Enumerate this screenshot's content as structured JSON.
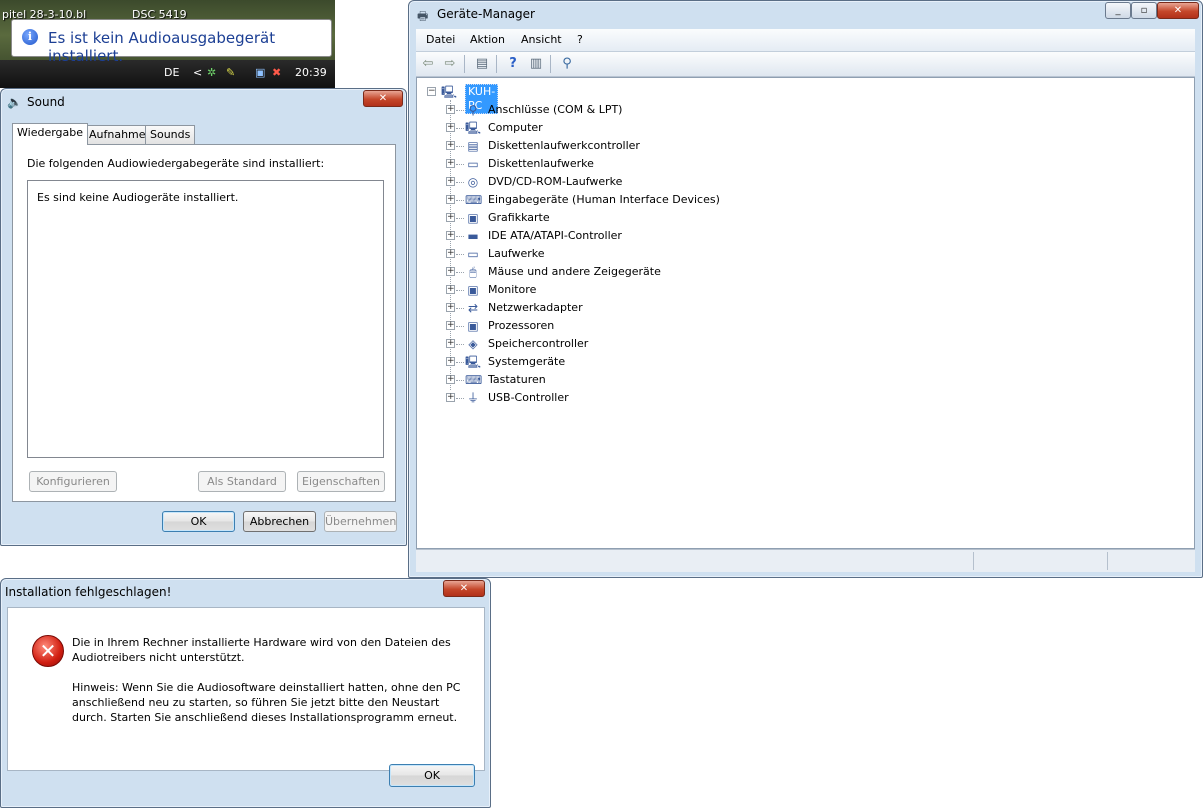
{
  "desktop": {
    "label_left": "pitel 28-3-10.bl",
    "label_right": "DSC 5419"
  },
  "balloon": {
    "icon": "info-icon",
    "message": "Es ist kein Audioausgabegerät installiert."
  },
  "taskbar": {
    "language": "DE",
    "chevron": "<",
    "time": "20:39"
  },
  "device_manager": {
    "title": "Geräte-Manager",
    "menu": [
      "Datei",
      "Aktion",
      "Ansicht",
      "?"
    ],
    "root": "KUH-PC",
    "nodes": [
      {
        "label": "Anschlüsse (COM & LPT)",
        "icon": "port-icon"
      },
      {
        "label": "Computer",
        "icon": "computer-icon"
      },
      {
        "label": "Diskettenlaufwerkcontroller",
        "icon": "floppy-controller-icon"
      },
      {
        "label": "Diskettenlaufwerke",
        "icon": "floppy-drive-icon"
      },
      {
        "label": "DVD/CD-ROM-Laufwerke",
        "icon": "cdrom-icon"
      },
      {
        "label": "Eingabegeräte (Human Interface Devices)",
        "icon": "hid-icon"
      },
      {
        "label": "Grafikkarte",
        "icon": "display-adapter-icon"
      },
      {
        "label": "IDE ATA/ATAPI-Controller",
        "icon": "ide-controller-icon"
      },
      {
        "label": "Laufwerke",
        "icon": "disk-drive-icon"
      },
      {
        "label": "Mäuse und andere Zeigegeräte",
        "icon": "mouse-icon"
      },
      {
        "label": "Monitore",
        "icon": "monitor-icon"
      },
      {
        "label": "Netzwerkadapter",
        "icon": "network-adapter-icon"
      },
      {
        "label": "Prozessoren",
        "icon": "processor-icon"
      },
      {
        "label": "Speichercontroller",
        "icon": "storage-controller-icon"
      },
      {
        "label": "Systemgeräte",
        "icon": "system-device-icon"
      },
      {
        "label": "Tastaturen",
        "icon": "keyboard-icon"
      },
      {
        "label": "USB-Controller",
        "icon": "usb-icon"
      }
    ]
  },
  "sound_dialog": {
    "title": "Sound",
    "tabs": [
      "Wiedergabe",
      "Aufnahme",
      "Sounds"
    ],
    "description": "Die folgenden Audiowiedergabegeräte sind installiert:",
    "empty_text": "Es sind keine Audiogeräte installiert.",
    "buttons": {
      "configure": "Konfigurieren",
      "set_default": "Als Standard",
      "properties": "Eigenschaften",
      "ok": "OK",
      "cancel": "Abbrechen",
      "apply": "Übernehmen"
    }
  },
  "install_dialog": {
    "title": "Installation fehlgeschlagen!",
    "message": "Die in Ihrem Rechner installierte Hardware wird von den Dateien des Audiotreibers nicht unterstützt.",
    "hint": "Hinweis: Wenn Sie die Audiosoftware deinstalliert hatten, ohne den PC anschließend neu zu starten, so führen Sie jetzt bitte den Neustart durch. Starten Sie anschließend dieses Installationsprogramm erneut.",
    "ok": "OK"
  },
  "colors": {
    "selection": "#3399ff",
    "window_frame": "#cfe0f0",
    "close_button": "#c5472a",
    "error_icon": "#d11f12",
    "balloon_text": "#1c3f94"
  }
}
